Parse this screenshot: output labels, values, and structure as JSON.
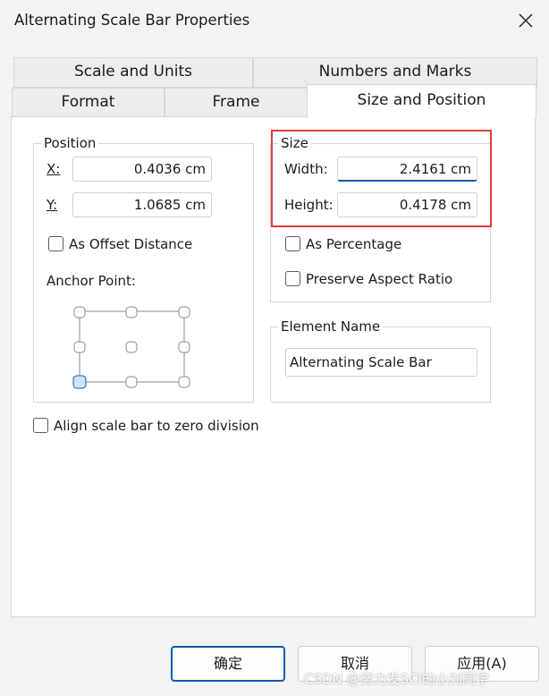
{
  "window": {
    "title": "Alternating Scale Bar Properties"
  },
  "tabs": [
    {
      "label": "Scale and Units"
    },
    {
      "label": "Numbers and Marks"
    },
    {
      "label": "Format"
    },
    {
      "label": "Frame"
    },
    {
      "label": "Size and Position",
      "active": true
    }
  ],
  "position": {
    "title": "Position",
    "x_label": "X:",
    "x_value": "0.4036 cm",
    "y_label": "Y:",
    "y_value": "1.0685 cm",
    "offset_label": "As Offset Distance",
    "offset_checked": false,
    "anchor_label": "Anchor Point:"
  },
  "size": {
    "title": "Size",
    "width_label": "Width:",
    "width_value": "2.4161 cm",
    "height_label": "Height:",
    "height_value": "0.4178 cm",
    "percentage_label": "As Percentage",
    "percentage_checked": false,
    "aspect_label": "Preserve Aspect Ratio",
    "aspect_checked": false
  },
  "element": {
    "title": "Element Name",
    "value": "Alternating Scale Bar"
  },
  "align": {
    "label": "Align scale bar to zero division",
    "checked": false
  },
  "buttons": {
    "ok": "确定",
    "cancel": "取消",
    "apply": "应用(A)"
  },
  "watermark": "CSDN @努力发SCI的小刘同学",
  "colors": {
    "accent": "#0b5cad",
    "highlight": "#e03c3c",
    "anchor_selected": "#cfe3f7"
  }
}
